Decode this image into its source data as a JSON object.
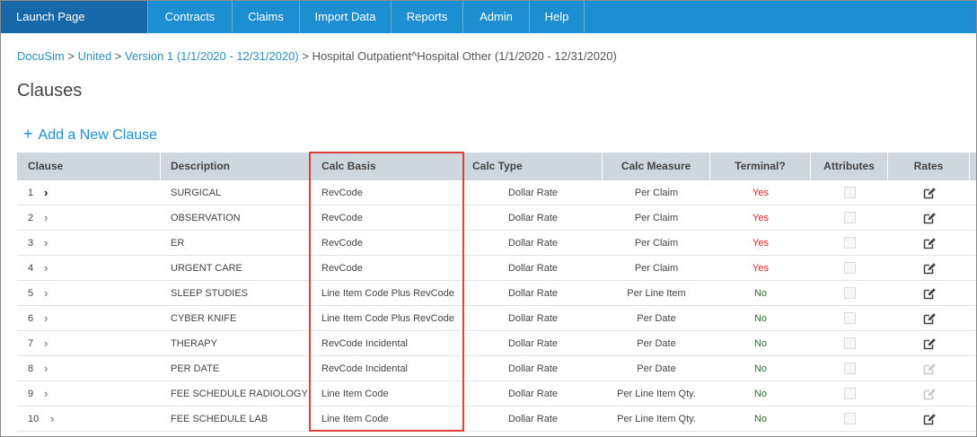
{
  "nav": {
    "launch": "Launch Page",
    "items": [
      {
        "label": "Contracts"
      },
      {
        "label": "Claims"
      },
      {
        "label": "Import Data"
      },
      {
        "label": "Reports"
      },
      {
        "label": "Admin"
      },
      {
        "label": "Help"
      }
    ]
  },
  "breadcrumb": {
    "items": [
      "DocuSim",
      "United",
      "Version 1 (1/1/2020 - 12/31/2020)"
    ],
    "separator": ">",
    "current": "Hospital Outpatient^Hospital Other (1/1/2020 - 12/31/2020)"
  },
  "page": {
    "title": "Clauses",
    "add_label": "Add a New Clause",
    "add_icon": "plus-icon"
  },
  "table": {
    "columns": [
      "Clause",
      "Description",
      "Calc Basis",
      "Calc Type",
      "Calc Measure",
      "Terminal?",
      "Attributes",
      "Rates"
    ],
    "rows": [
      {
        "clause": "1",
        "description": "SURGICAL",
        "calc_basis": "RevCode",
        "calc_type": "Dollar Rate",
        "calc_measure": "Per Claim",
        "terminal": "Yes",
        "rates_enabled": true,
        "expanded": true
      },
      {
        "clause": "2",
        "description": "OBSERVATION",
        "calc_basis": "RevCode",
        "calc_type": "Dollar Rate",
        "calc_measure": "Per Claim",
        "terminal": "Yes",
        "rates_enabled": true
      },
      {
        "clause": "3",
        "description": "ER",
        "calc_basis": "RevCode",
        "calc_type": "Dollar Rate",
        "calc_measure": "Per Claim",
        "terminal": "Yes",
        "rates_enabled": true
      },
      {
        "clause": "4",
        "description": "URGENT CARE",
        "calc_basis": "RevCode",
        "calc_type": "Dollar Rate",
        "calc_measure": "Per Claim",
        "terminal": "Yes",
        "rates_enabled": true
      },
      {
        "clause": "5",
        "description": "SLEEP STUDIES",
        "calc_basis": "Line Item Code Plus RevCode",
        "calc_type": "Dollar Rate",
        "calc_measure": "Per Line Item",
        "terminal": "No",
        "rates_enabled": true
      },
      {
        "clause": "6",
        "description": "CYBER KNIFE",
        "calc_basis": "Line Item Code Plus RevCode",
        "calc_type": "Dollar Rate",
        "calc_measure": "Per Date",
        "terminal": "No",
        "rates_enabled": true
      },
      {
        "clause": "7",
        "description": "THERAPY",
        "calc_basis": "RevCode Incidental",
        "calc_type": "Dollar Rate",
        "calc_measure": "Per Date",
        "terminal": "No",
        "rates_enabled": true
      },
      {
        "clause": "8",
        "description": "PER DATE",
        "calc_basis": "RevCode Incidental",
        "calc_type": "Dollar Rate",
        "calc_measure": "Per Date",
        "terminal": "No",
        "rates_enabled": false
      },
      {
        "clause": "9",
        "description": "FEE SCHEDULE RADIOLOGY",
        "calc_basis": "Line Item Code",
        "calc_type": "Dollar Rate",
        "calc_measure": "Per Line Item Qty.",
        "terminal": "No",
        "rates_enabled": false
      },
      {
        "clause": "10",
        "description": "FEE SCHEDULE LAB",
        "calc_basis": "Line Item Code",
        "calc_type": "Dollar Rate",
        "calc_measure": "Per Line Item Qty.",
        "terminal": "No",
        "rates_enabled": true
      }
    ]
  },
  "colors": {
    "nav": "#1d8fd0",
    "nav_active": "#1768a8",
    "link": "#2a8fc4",
    "yes": "#e02020",
    "no": "#2e6e2e",
    "highlight": "#e03c3c"
  }
}
